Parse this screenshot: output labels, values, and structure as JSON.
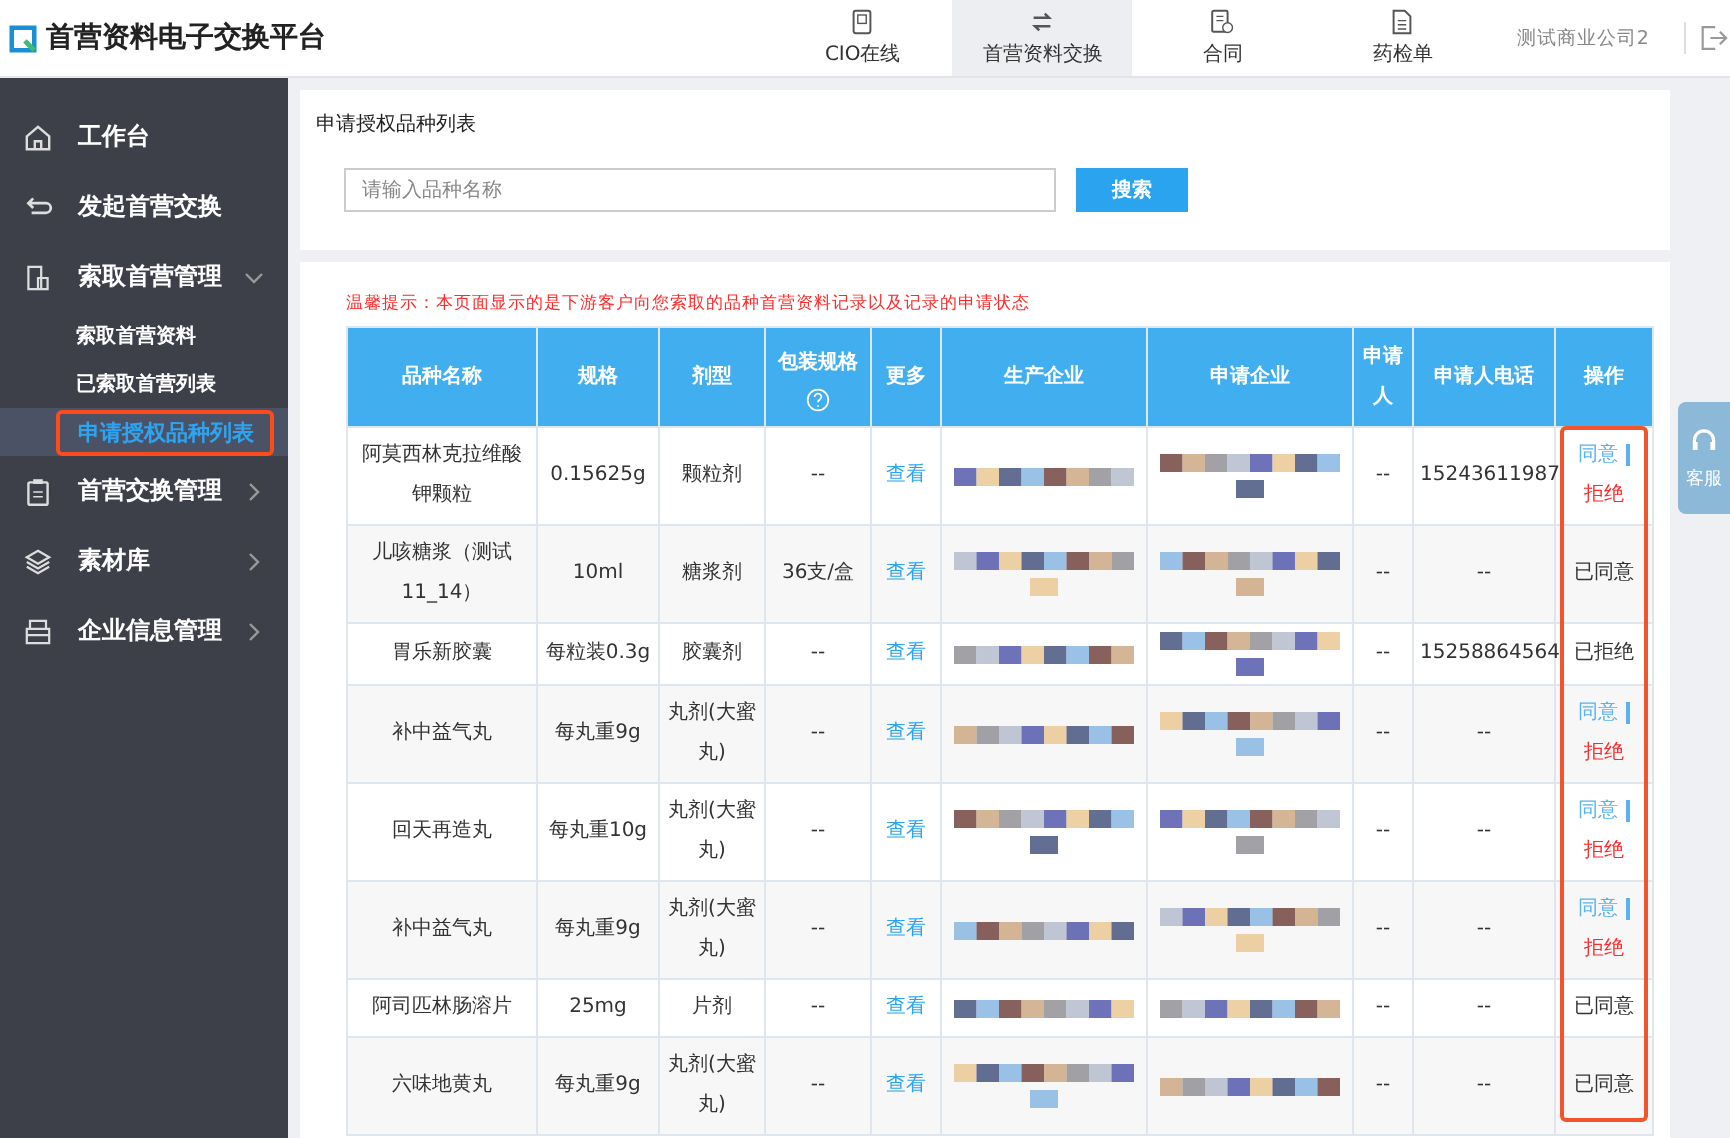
{
  "app": {
    "title": "首营资料电子交换平台"
  },
  "top_nav": [
    {
      "label": "CIO在线",
      "selected": false
    },
    {
      "label": "首营资料交换",
      "selected": true
    },
    {
      "label": "合同",
      "selected": false
    },
    {
      "label": "药检单",
      "selected": false
    }
  ],
  "account": "测试商业公司2",
  "sidebar": [
    {
      "label": "工作台",
      "kind": "link"
    },
    {
      "label": "发起首营交换",
      "kind": "link"
    },
    {
      "label": "索取首营管理",
      "kind": "group",
      "expanded": true,
      "children": [
        {
          "label": "索取首营资料",
          "selected": false
        },
        {
          "label": "已索取首营列表",
          "selected": false
        },
        {
          "label": "申请授权品种列表",
          "selected": true
        }
      ]
    },
    {
      "label": "首营交换管理",
      "kind": "group",
      "expanded": false
    },
    {
      "label": "素材库",
      "kind": "group",
      "expanded": false
    },
    {
      "label": "企业信息管理",
      "kind": "group",
      "expanded": false
    }
  ],
  "page_title": "申请授权品种列表",
  "search": {
    "placeholder": "请输入品种名称",
    "button": "搜索"
  },
  "notice": "温馨提示：本页面显示的是下游客户向您索取的品种首营资料记录以及记录的申请状态",
  "table": {
    "columns": [
      {
        "label": "品种名称"
      },
      {
        "label": "规格"
      },
      {
        "label": "剂型"
      },
      {
        "label": "包装规格",
        "help": true
      },
      {
        "label": "更多"
      },
      {
        "label": "生产企业"
      },
      {
        "label": "申请企业"
      },
      {
        "label": "申请人"
      },
      {
        "label": "申请人电话"
      },
      {
        "label": "操作"
      }
    ],
    "rows": [
      {
        "name": "阿莫西林克拉维酸钾颗粒",
        "spec": "0.15625g",
        "form": "颗粒剂",
        "pack": "--",
        "more": "查看",
        "applicant": "--",
        "phone": "15243611987",
        "action": {
          "kind": "pending",
          "agree": "同意",
          "reject": "拒绝"
        }
      },
      {
        "name": "儿咳糖浆（测试11_14）",
        "spec": "10ml",
        "form": "糖浆剂",
        "pack": "36支/盒",
        "more": "查看",
        "applicant": "--",
        "phone": "--",
        "action": {
          "kind": "done",
          "text": "已同意"
        }
      },
      {
        "name": "胃乐新胶囊",
        "spec": "每粒装0.3g",
        "form": "胶囊剂",
        "pack": "--",
        "more": "查看",
        "applicant": "--",
        "phone": "15258864564",
        "action": {
          "kind": "done",
          "text": "已拒绝"
        }
      },
      {
        "name": "补中益气丸",
        "spec": "每丸重9g",
        "form": "丸剂(大蜜丸)",
        "pack": "--",
        "more": "查看",
        "applicant": "--",
        "phone": "--",
        "action": {
          "kind": "pending",
          "agree": "同意",
          "reject": "拒绝"
        }
      },
      {
        "name": "回天再造丸",
        "spec": "每丸重10g",
        "form": "丸剂(大蜜丸)",
        "pack": "--",
        "more": "查看",
        "applicant": "--",
        "phone": "--",
        "action": {
          "kind": "pending",
          "agree": "同意",
          "reject": "拒绝"
        }
      },
      {
        "name": "补中益气丸",
        "spec": "每丸重9g",
        "form": "丸剂(大蜜丸)",
        "pack": "--",
        "more": "查看",
        "applicant": "--",
        "phone": "--",
        "action": {
          "kind": "pending",
          "agree": "同意",
          "reject": "拒绝"
        }
      },
      {
        "name": "阿司匹林肠溶片",
        "spec": "25mg",
        "form": "片剂",
        "pack": "--",
        "more": "查看",
        "applicant": "--",
        "phone": "--",
        "action": {
          "kind": "done",
          "text": "已同意"
        }
      },
      {
        "name": "六味地黄丸",
        "spec": "每丸重9g",
        "form": "丸剂(大蜜丸)",
        "pack": "--",
        "more": "查看",
        "applicant": "--",
        "phone": "--",
        "action": {
          "kind": "done",
          "text": "已同意"
        }
      }
    ]
  },
  "support": {
    "label": "客服"
  }
}
